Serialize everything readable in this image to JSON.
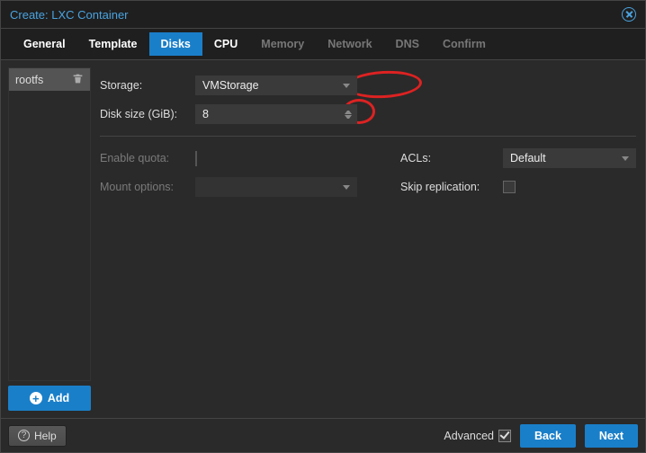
{
  "window": {
    "title": "Create: LXC Container"
  },
  "tabs": [
    {
      "label": "General",
      "state": "normal"
    },
    {
      "label": "Template",
      "state": "normal"
    },
    {
      "label": "Disks",
      "state": "active"
    },
    {
      "label": "CPU",
      "state": "normal"
    },
    {
      "label": "Memory",
      "state": "disabled"
    },
    {
      "label": "Network",
      "state": "disabled"
    },
    {
      "label": "DNS",
      "state": "disabled"
    },
    {
      "label": "Confirm",
      "state": "disabled"
    }
  ],
  "sidebar": {
    "items": [
      {
        "label": "rootfs"
      }
    ],
    "add_label": "Add"
  },
  "form": {
    "storage": {
      "label": "Storage:",
      "value": "VMStorage"
    },
    "disk_size": {
      "label": "Disk size (GiB):",
      "value": "8"
    },
    "enable_quota": {
      "label": "Enable quota:"
    },
    "acls": {
      "label": "ACLs:",
      "value": "Default"
    },
    "mount_opts": {
      "label": "Mount options:",
      "value": ""
    },
    "skip_repl": {
      "label": "Skip replication:"
    }
  },
  "footer": {
    "help": "Help",
    "advanced": "Advanced",
    "back": "Back",
    "next": "Next"
  }
}
